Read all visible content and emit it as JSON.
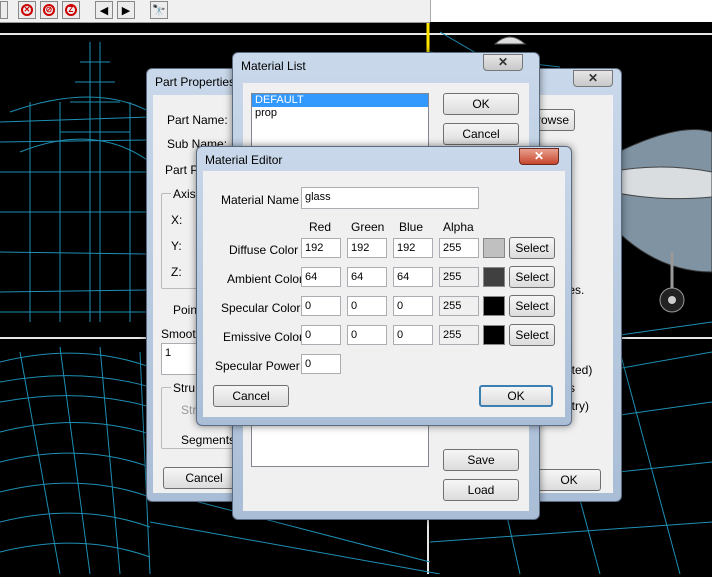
{
  "colors": {
    "selection": "#3399ff",
    "viewport_bg": "#000000",
    "wire": "#1e8fb4",
    "grid_line": "#e6e6e6"
  },
  "toolbar": {
    "icons": [
      "no-select-icon",
      "no-select-icon",
      "no-select-icon",
      "left-arrow-icon",
      "right-arrow-icon",
      "binoculars-icon"
    ],
    "left_arrow": "◀",
    "right_arrow": "▶",
    "binoculars": "🔭"
  },
  "part_properties": {
    "title": "Part Properties",
    "part_name_label": "Part Name:",
    "sub_name_label": "Sub Name:",
    "part_pa_label": "Part Pa",
    "axis_label": "Axis",
    "x_label": "X:",
    "y_label": "Y:",
    "z_label": "Z:",
    "point_label": "Poin",
    "smooth_label": "Smoot",
    "smooth_value": "1",
    "struct_label": "Stru",
    "str_label": "Str",
    "segments_label": "Segments:",
    "cancel_label": "Cancel"
  },
  "right_window": {
    "close": "✕",
    "browse_label": "rowse",
    "tes_label": "tes.",
    "ated_label": "ated)",
    "s_label": "s",
    "etry_label": "etry)",
    "ok_label": "OK"
  },
  "material_list": {
    "title": "Material List",
    "items": [
      "DEFAULT",
      "prop"
    ],
    "ok_label": "OK",
    "cancel_label": "Cancel",
    "save_label": "Save",
    "load_label": "Load",
    "close": "✕"
  },
  "material_editor": {
    "title": "Material Editor",
    "close": "✕",
    "name_label": "Material Name",
    "name_value": "glass",
    "headers": [
      "Red",
      "Green",
      "Blue",
      "Alpha"
    ],
    "rows": [
      {
        "label": "Diffuse Color",
        "r": "192",
        "g": "192",
        "b": "192",
        "a": "255",
        "swatch": "#c0c0c0",
        "select": "Select"
      },
      {
        "label": "Ambient Color",
        "r": "64",
        "g": "64",
        "b": "64",
        "a": "255",
        "swatch": "#404040",
        "select": "Select"
      },
      {
        "label": "Specular Color",
        "r": "0",
        "g": "0",
        "b": "0",
        "a": "255",
        "swatch": "#000000",
        "select": "Select"
      },
      {
        "label": "Emissive Color",
        "r": "0",
        "g": "0",
        "b": "0",
        "a": "255",
        "swatch": "#000000",
        "select": "Select"
      }
    ],
    "power_label": "Specular Power",
    "power_value": "0",
    "cancel_label": "Cancel",
    "ok_label": "OK"
  }
}
